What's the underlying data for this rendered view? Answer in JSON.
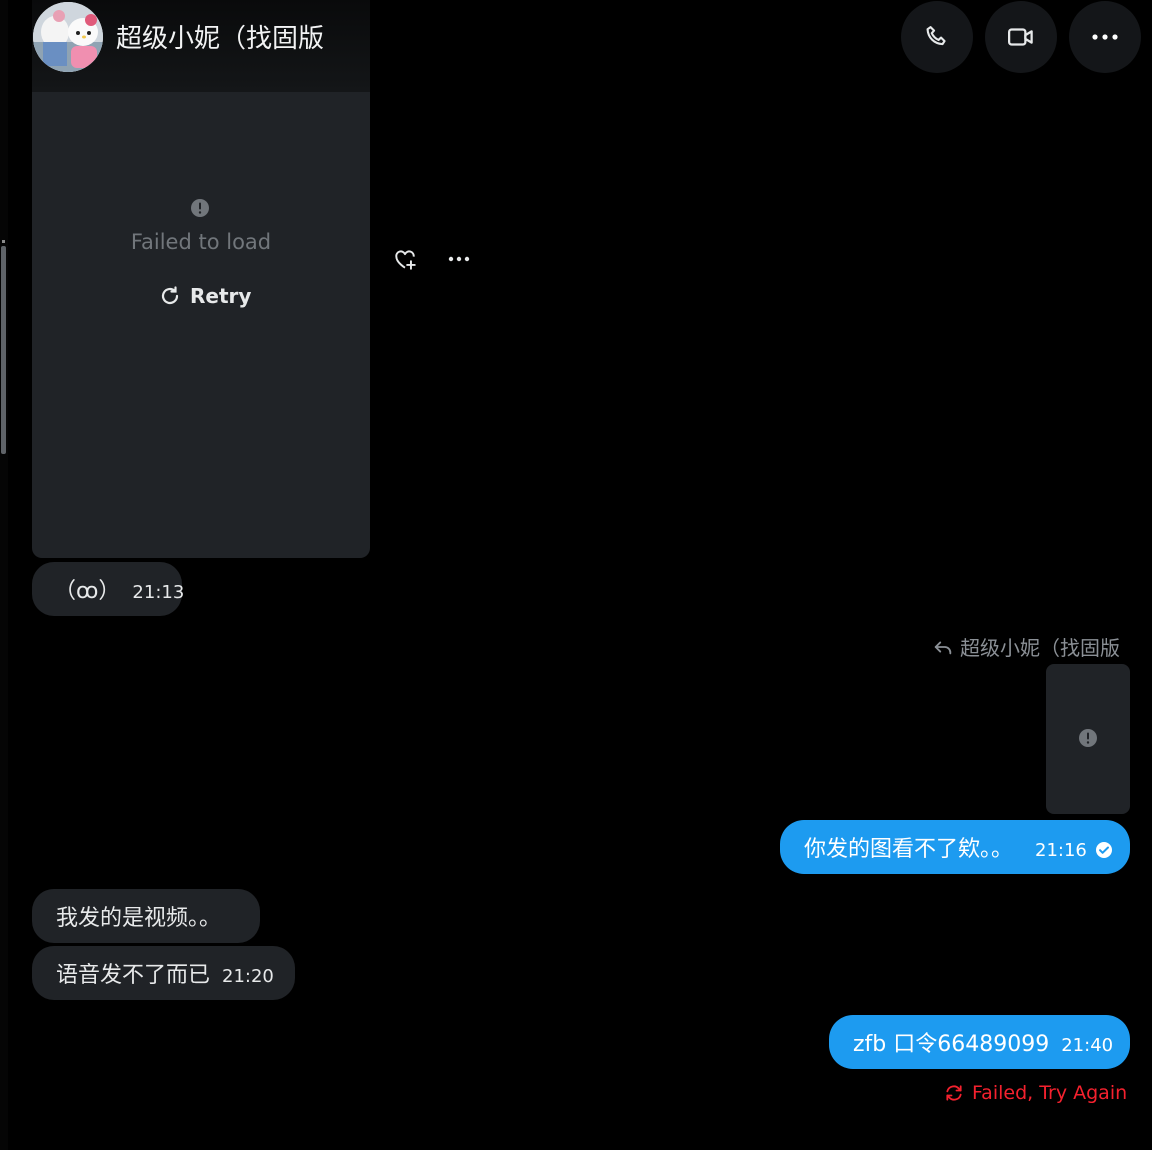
{
  "header": {
    "contact_name": "超级小妮（找固版",
    "avatar_icon": "avatar-image",
    "call_icon": "phone-icon",
    "video_icon": "video-call-icon",
    "more_icon": "more-icon"
  },
  "media_message": {
    "error_icon": "alert-circle-icon",
    "failed_text": "Failed to load",
    "retry_label": "Retry",
    "retry_icon": "refresh-icon",
    "actions": [
      "add-reaction-icon",
      "more-icon"
    ]
  },
  "messages": [
    {
      "direction": "in",
      "text": "（ꝏ）",
      "time": "21:13"
    },
    {
      "direction": "out",
      "reply_to": "超级小妮（找固版",
      "media_failed": true
    },
    {
      "direction": "out",
      "text": "你发的图看不了欸。。",
      "time": "21:16",
      "status_icon": "read-check-icon"
    },
    {
      "direction": "in",
      "text": "我发的是视频。。",
      "time": ""
    },
    {
      "direction": "in",
      "text": "语音发不了而已",
      "time": "21:20"
    },
    {
      "direction": "out",
      "text": "zfb 口令66489099",
      "time": "21:40"
    }
  ],
  "send_error": {
    "text": "Failed, Try Again",
    "icon": "retry-icon"
  },
  "colors": {
    "background": "#000000",
    "bubble_in": "#202327",
    "bubble_out": "#1d9bf0",
    "error": "#f4212e",
    "muted": "#71767b"
  }
}
